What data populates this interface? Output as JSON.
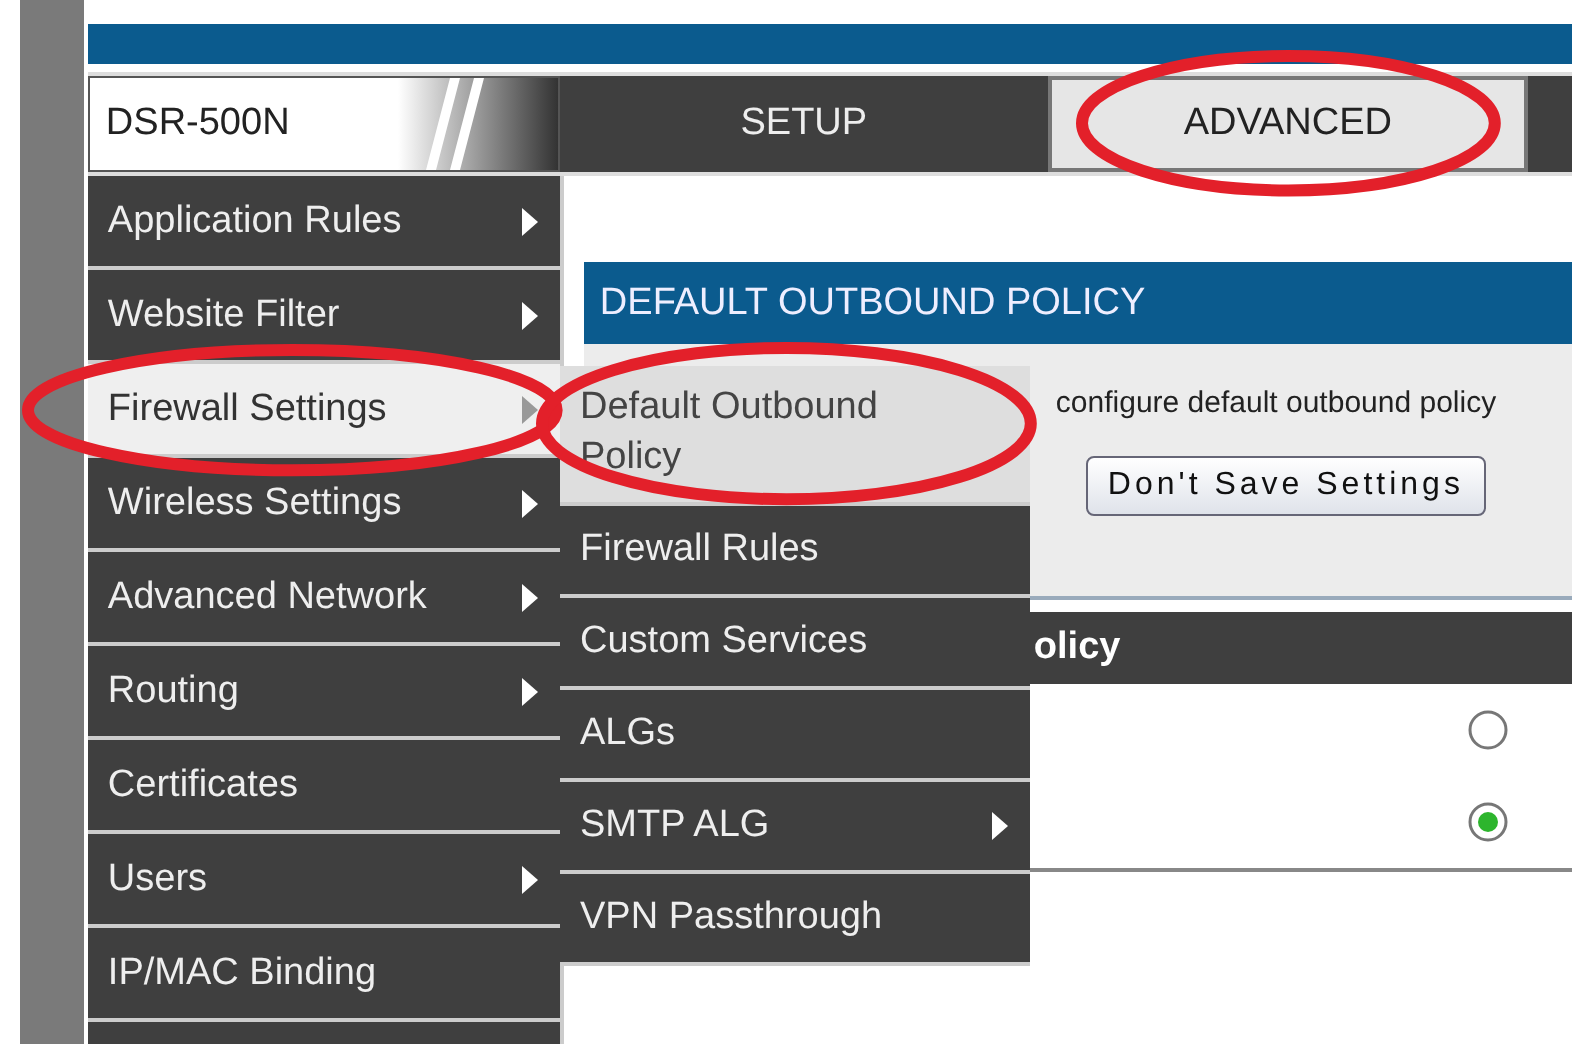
{
  "brand": "DSR-500N",
  "tabs": [
    {
      "label": "SETUP",
      "selected": false,
      "highlighted": false
    },
    {
      "label": "ADVANCED",
      "selected": true,
      "highlighted": true
    }
  ],
  "sidebar": {
    "items": [
      {
        "label": "Application Rules",
        "has_submenu": true,
        "selected": false,
        "highlighted": false
      },
      {
        "label": "Website Filter",
        "has_submenu": true,
        "selected": false,
        "highlighted": false
      },
      {
        "label": "Firewall Settings",
        "has_submenu": true,
        "selected": true,
        "highlighted": true
      },
      {
        "label": "Wireless Settings",
        "has_submenu": true,
        "selected": false,
        "highlighted": false
      },
      {
        "label": "Advanced Network",
        "has_submenu": true,
        "selected": false,
        "highlighted": false
      },
      {
        "label": "Routing",
        "has_submenu": true,
        "selected": false,
        "highlighted": false
      },
      {
        "label": "Certificates",
        "has_submenu": false,
        "selected": false,
        "highlighted": false
      },
      {
        "label": "Users",
        "has_submenu": true,
        "selected": false,
        "highlighted": false
      },
      {
        "label": "IP/MAC Binding",
        "has_submenu": false,
        "selected": false,
        "highlighted": false
      }
    ]
  },
  "submenu": {
    "items": [
      {
        "label": "Default Outbound Policy",
        "has_submenu": false,
        "selected": true,
        "highlighted": true
      },
      {
        "label": "Firewall Rules",
        "has_submenu": false,
        "selected": false,
        "highlighted": false
      },
      {
        "label": "Custom Services",
        "has_submenu": false,
        "selected": false,
        "highlighted": false
      },
      {
        "label": "ALGs",
        "has_submenu": false,
        "selected": false,
        "highlighted": false
      },
      {
        "label": "SMTP ALG",
        "has_submenu": true,
        "selected": false,
        "highlighted": false
      },
      {
        "label": "VPN Passthrough",
        "has_submenu": false,
        "selected": false,
        "highlighted": false
      }
    ]
  },
  "panel": {
    "title": "DEFAULT OUTBOUND POLICY",
    "description": "configure default outbound policy",
    "buttons": [
      "Don't Save Settings"
    ]
  },
  "policy_section": {
    "title": "olicy",
    "options": [
      {
        "selected": false
      },
      {
        "selected": true
      }
    ]
  }
}
